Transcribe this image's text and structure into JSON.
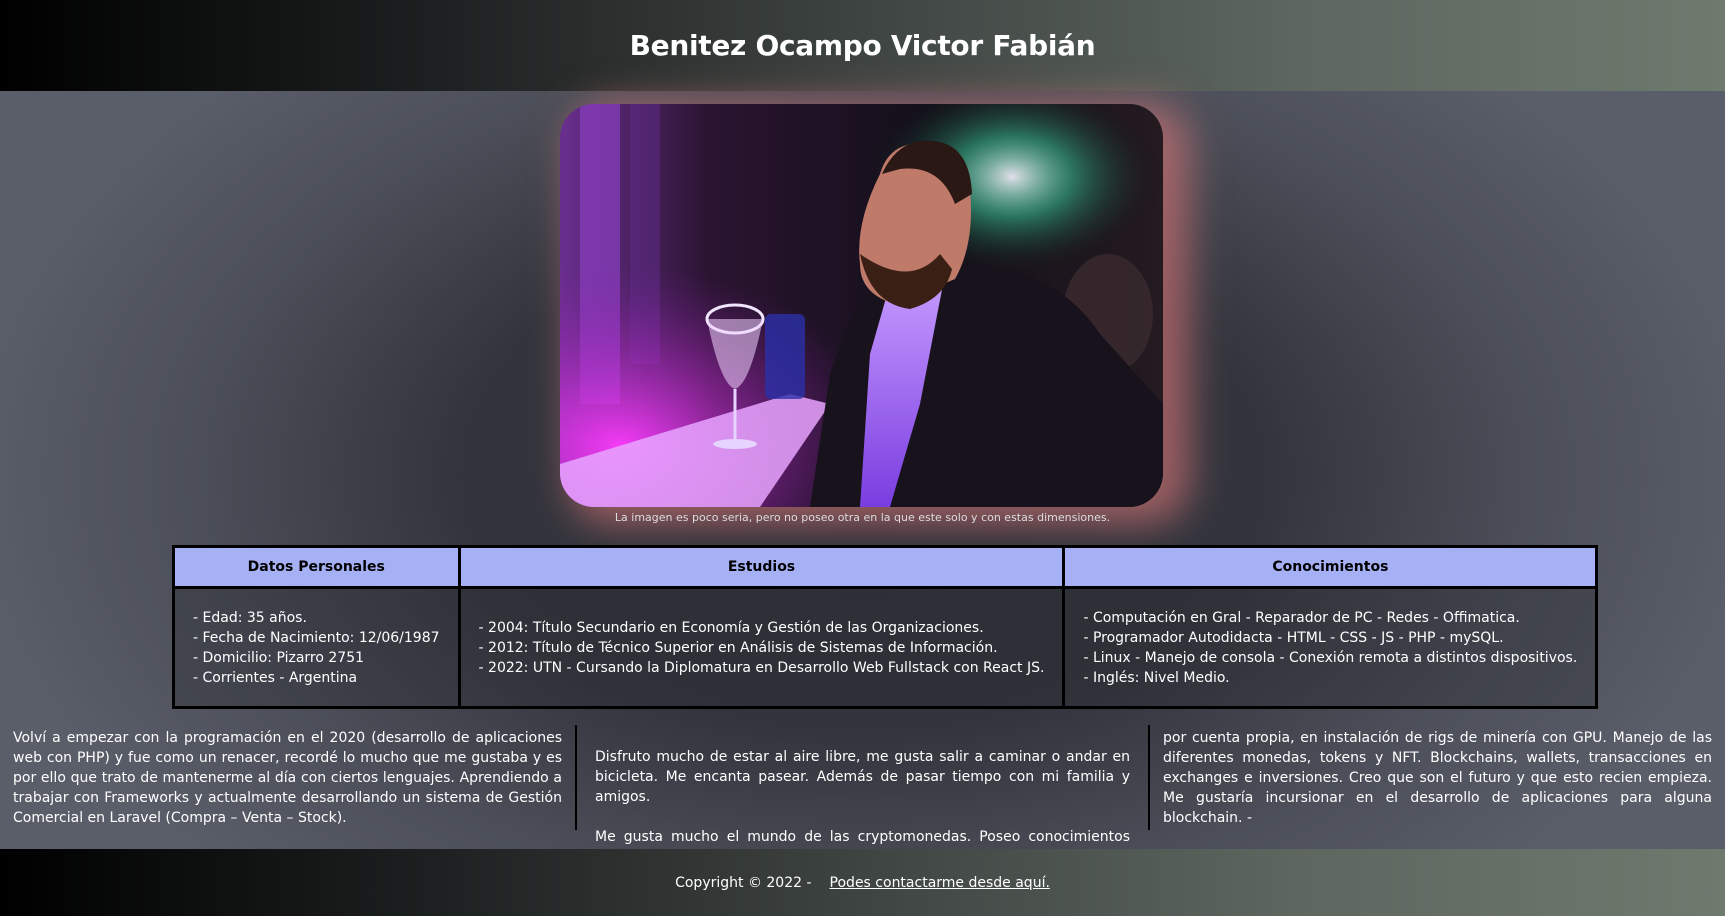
{
  "header": {
    "title": "Benitez Ocampo Victor Fabián"
  },
  "photo": {
    "caption": "La imagen es poco seria, pero no poseo otra en la que este solo y con estas dimensiones."
  },
  "table": {
    "headers": [
      "Datos Personales",
      "Estudios",
      "Conocimientos"
    ],
    "personal": [
      "- Edad: 35 años.",
      "- Fecha de Nacimiento: 12/06/1987",
      "- Domicilio: Pizarro 2751",
      "- Corrientes - Argentina"
    ],
    "studies": [
      "- 2004: Título Secundario en Economía y Gestión de las Organizaciones.",
      "- 2012: Título de Técnico Superior en Análisis de Sistemas de Información.",
      "- 2022: UTN - Cursando la Diplomatura en Desarrollo Web Fullstack con React JS."
    ],
    "skills": [
      "- Computación en Gral - Reparador de PC - Redes - Offimatica.",
      "- Programador Autodidacta - HTML - CSS - JS - PHP - mySQL.",
      "- Linux - Manejo de consola - Conexión remota a distintos dispositivos.",
      "- Inglés: Nivel Medio."
    ]
  },
  "about": {
    "col1": "Volví a empezar con la programación en el 2020 (desarrollo de aplicaciones web con PHP) y fue como un renacer, recordé lo mucho que me gustaba y es por ello que trato de mantenerme al día con ciertos lenguajes. Aprendiendo a trabajar con Frameworks y actualmente desarrollando un sistema de Gestión Comercial en Laravel (Compra – Venta – Stock).",
    "col2a": "Disfruto mucho de estar al aire libre, me gusta salir a caminar o andar en bicicleta. Me encanta pasear. Además de pasar tiempo con mi familia y amigos.",
    "col2b": "Me gusta mucho el mundo de las cryptomonedas. Poseo conocimientos avanzados,",
    "col3": "por cuenta propia, en instalación de rigs de minería con GPU. Manejo de las diferentes monedas, tokens y NFT. Blockchains, wallets, transacciones en exchanges e inversiones. Creo que son el futuro y que esto recien empieza. Me gustaría incursionar en el desarrollo de aplicaciones para alguna blockchain. -"
  },
  "footer": {
    "copyright": "Copyright © 2022 -",
    "contact_link": "Podes contactarme desde aquí."
  }
}
